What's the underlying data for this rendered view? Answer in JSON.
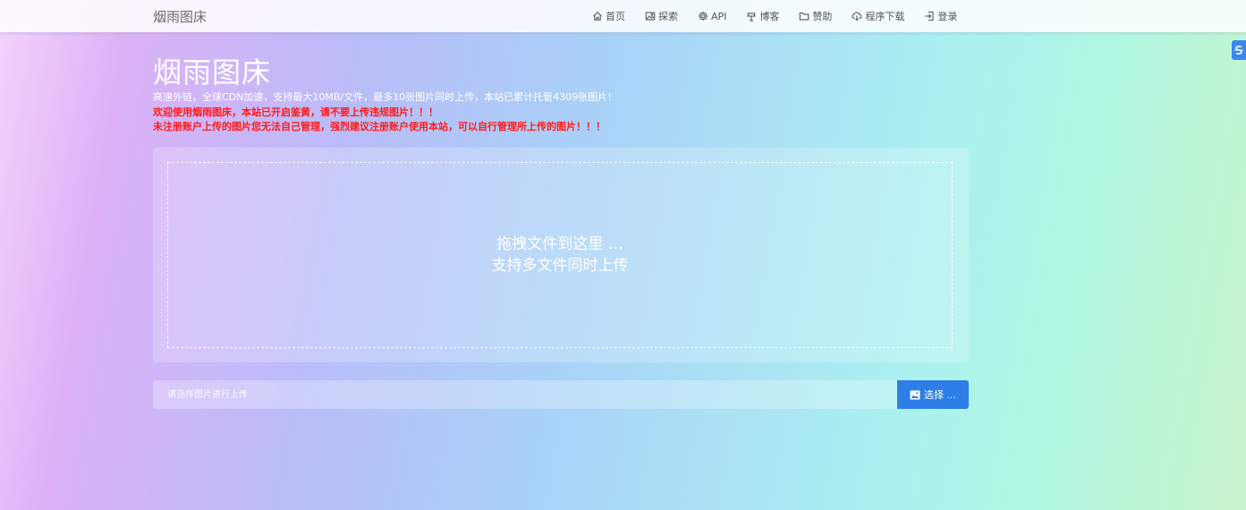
{
  "navbar": {
    "brand": "烟雨图床",
    "items": [
      {
        "label": "首页",
        "icon": "home-icon"
      },
      {
        "label": "探索",
        "icon": "image-icon"
      },
      {
        "label": "API",
        "icon": "gear-icon"
      },
      {
        "label": "博客",
        "icon": "blog-icon"
      },
      {
        "label": "赞助",
        "icon": "folder-icon"
      },
      {
        "label": "程序下载",
        "icon": "cloud-download-icon"
      },
      {
        "label": "登录",
        "icon": "login-icon"
      }
    ]
  },
  "hero": {
    "title": "烟雨图床",
    "description": "高速外链，全球CDN加速，支持最大10MB/文件，最多10张图片同时上传，本站已累计托管4309张图片！",
    "notice_1": "欢迎使用烟雨图床，本站已开启鉴黄，请不要上传违规图片！！！",
    "notice_2": "未注册账户上传的图片您无法自己管理，强烈建议注册账户使用本站，可以自行管理所上传的图片！！！"
  },
  "dropzone": {
    "line_1": "拖拽文件到这里 …",
    "line_2": "支持多文件同时上传"
  },
  "upload": {
    "placeholder": "请选择图片进行上传",
    "button_label": "选择 …"
  },
  "colors": {
    "accent": "#2d7fe7",
    "warning": "#ff1a1a"
  }
}
